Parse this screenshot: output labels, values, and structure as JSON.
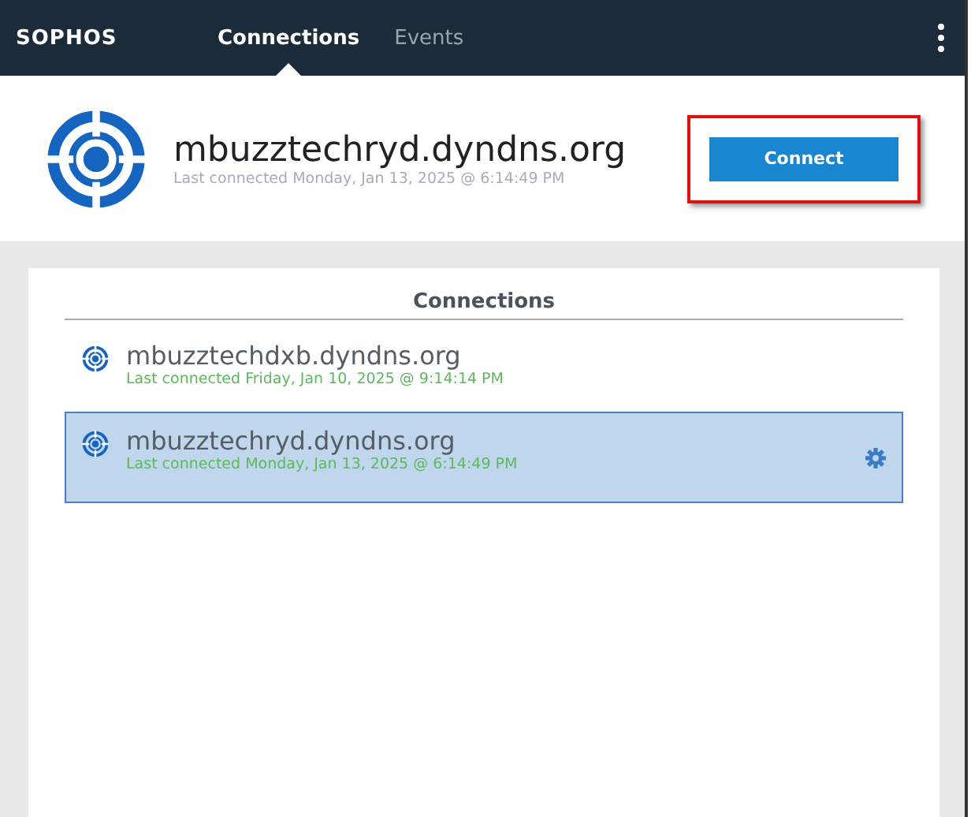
{
  "header": {
    "logo": "SOPHOS",
    "tabs": [
      {
        "label": "Connections",
        "selected": true
      },
      {
        "label": "Events",
        "selected": false
      }
    ]
  },
  "current": {
    "name": "mbuzztechryd.dyndns.org",
    "last_connected": "Last connected Monday, Jan 13, 2025 @ 6:14:49 PM",
    "button": "Connect",
    "highlighted": true
  },
  "list": {
    "title": "Connections",
    "items": [
      {
        "name": "mbuzztechdxb.dyndns.org",
        "last_connected": "Last connected Friday, Jan 10, 2025 @ 9:14:14 PM",
        "selected": false
      },
      {
        "name": "mbuzztechryd.dyndns.org",
        "last_connected": "Last connected Monday, Jan 13, 2025 @ 6:14:49 PM",
        "selected": true
      }
    ]
  }
}
